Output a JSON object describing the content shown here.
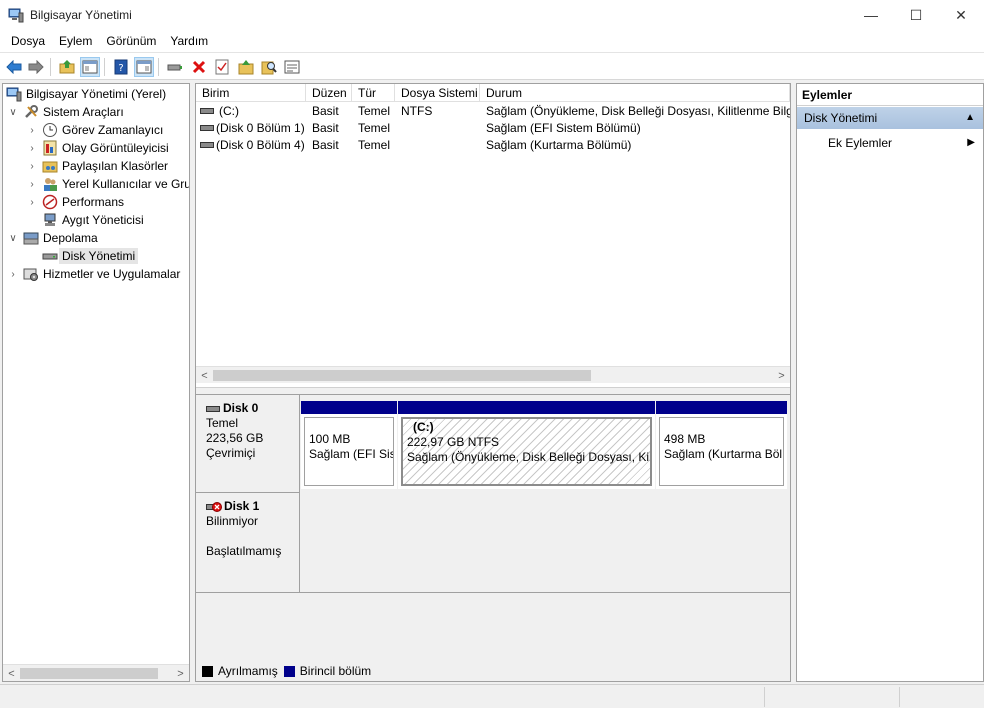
{
  "window": {
    "title": "Bilgisayar Yönetimi",
    "minimize_glyph": "—",
    "maximize_glyph": "☐",
    "close_glyph": "✕"
  },
  "menu": [
    "Dosya",
    "Eylem",
    "Görünüm",
    "Yardım"
  ],
  "toolbar": {
    "icons": [
      "back-arrow-icon",
      "forward-arrow-icon",
      "up-folder-icon",
      "show-hide-tree-icon",
      "help-icon",
      "show-hide-action-pane-icon",
      "connect-icon",
      "delete-icon",
      "properties-checklist-icon",
      "rescan-icon",
      "find-icon",
      "refresh-list-icon"
    ]
  },
  "tree": {
    "items": [
      {
        "label": "Bilgisayar Yönetimi (Yerel)",
        "icon": "computer-management-icon"
      },
      {
        "label": "Sistem Araçları",
        "icon": "system-tools-icon"
      },
      {
        "label": "Görev Zamanlayıcı",
        "icon": "clock-icon"
      },
      {
        "label": "Olay Görüntüleyicisi",
        "icon": "event-viewer-icon"
      },
      {
        "label": "Paylaşılan Klasörler",
        "icon": "shared-folders-icon"
      },
      {
        "label": "Yerel Kullanıcılar ve Gru",
        "icon": "users-icon"
      },
      {
        "label": "Performans",
        "icon": "performance-icon"
      },
      {
        "label": "Aygıt Yöneticisi",
        "icon": "device-manager-icon"
      },
      {
        "label": "Depolama",
        "icon": "storage-icon"
      },
      {
        "label": "Disk Yönetimi",
        "icon": "disk-management-icon"
      },
      {
        "label": "Hizmetler ve Uygulamalar",
        "icon": "services-icon"
      }
    ],
    "expanded_glyph": "∨",
    "collapsed_glyph": "›"
  },
  "volumes": {
    "headers": [
      "Birim",
      "Düzen",
      "Tür",
      "Dosya Sistemi",
      "Durum"
    ],
    "rows": [
      {
        "name": "(C:)",
        "layout": "Basit",
        "type": "Temel",
        "fs": "NTFS",
        "status": "Sağlam (Önyükleme, Disk Belleği Dosyası, Kilitlenme Bilgis"
      },
      {
        "name": "(Disk 0 Bölüm 1)",
        "layout": "Basit",
        "type": "Temel",
        "fs": "",
        "status": "Sağlam (EFI Sistem Bölümü)"
      },
      {
        "name": "(Disk 0 Bölüm 4)",
        "layout": "Basit",
        "type": "Temel",
        "fs": "",
        "status": "Sağlam (Kurtarma Bölümü)"
      }
    ]
  },
  "disks": {
    "disk0": {
      "name": "Disk 0",
      "type": "Temel",
      "size": "223,56 GB",
      "state": "Çevrimiçi",
      "partitions": [
        {
          "title": "",
          "size": "100 MB",
          "status": "Sağlam (EFI Sist"
        },
        {
          "title": "(C:)",
          "size": "222,97 GB NTFS",
          "status": "Sağlam (Önyükleme, Disk Belleği Dosyası, Kilit"
        },
        {
          "title": "",
          "size": "498 MB",
          "status": "Sağlam (Kurtarma Böl"
        }
      ]
    },
    "disk1": {
      "name": "Disk 1",
      "type": "Bilinmiyor",
      "state": "Başlatılmamış"
    }
  },
  "legend": [
    {
      "label": "Ayrılmamış",
      "color": "#000000"
    },
    {
      "label": "Birincil bölüm",
      "color": "#00008b"
    }
  ],
  "actions": {
    "title": "Eylemler",
    "section": "Disk Yönetimi",
    "item": "Ek Eylemler",
    "collapse_glyph": "▲",
    "submenu_glyph": "▶"
  },
  "scroll": {
    "left_glyph": "<",
    "right_glyph": ">"
  }
}
